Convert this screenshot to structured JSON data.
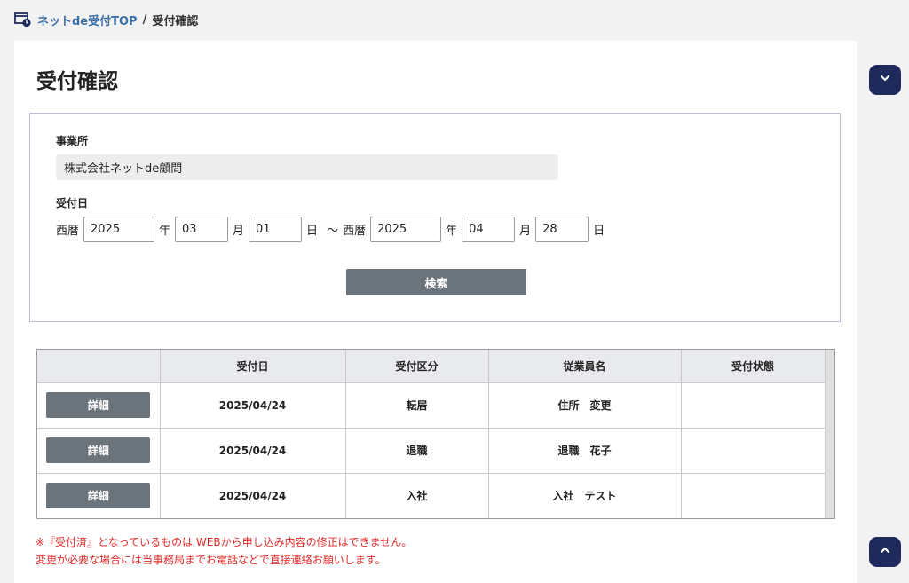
{
  "breadcrumb": {
    "home_label": "ネットde受付TOP",
    "separator": "/",
    "current": "受付確認"
  },
  "page": {
    "title": "受付確認"
  },
  "search": {
    "office_label": "事業所",
    "office_value": "株式会社ネットde顧問",
    "date_label": "受付日",
    "era_label": "西暦",
    "from": {
      "year": "2025",
      "month": "03",
      "day": "01"
    },
    "to": {
      "year": "2025",
      "month": "04",
      "day": "28"
    },
    "year_unit": "年",
    "month_unit": "月",
    "day_unit": "日",
    "range_sep": "〜",
    "button_label": "検索"
  },
  "table": {
    "headers": [
      "",
      "受付日",
      "受付区分",
      "従業員名",
      "受付状態"
    ],
    "detail_label": "詳細",
    "rows": [
      {
        "date": "2025/04/24",
        "category": "転居",
        "employee": "住所　変更",
        "status": ""
      },
      {
        "date": "2025/04/24",
        "category": "退職",
        "employee": "退職　花子",
        "status": ""
      },
      {
        "date": "2025/04/24",
        "category": "入社",
        "employee": "入社　テスト",
        "status": ""
      }
    ]
  },
  "notice": {
    "line1": "※『受付済』となっているものは WEBから申し込み内容の修正はできません。",
    "line2": "変更が必要な場合には当事務局までお電話などで直接連絡お願いします。"
  },
  "colors": {
    "accent": "#1f2a5c",
    "link": "#3a6ea5",
    "button": "#6b737b",
    "notice": "#e02a2a"
  },
  "icons": {
    "breadcrumb": "window-clock-icon",
    "scroll_down": "chevron-down-icon",
    "scroll_up": "chevron-up-icon"
  }
}
